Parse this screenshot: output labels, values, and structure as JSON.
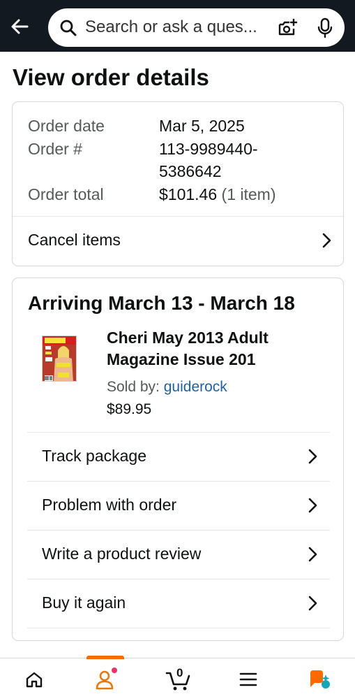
{
  "search": {
    "placeholder": "Search or ask a ques..."
  },
  "page": {
    "title": "View order details"
  },
  "order_summary": {
    "date_label": "Order date",
    "date_value": "Mar 5, 2025",
    "number_label": "Order #",
    "number_line1": "113-9989440-",
    "number_line2": "5386642",
    "total_label": "Order total",
    "total_value": "$101.46",
    "total_items": "(1 item)",
    "cancel_label": "Cancel items"
  },
  "shipment": {
    "arriving": "Arriving March 13 - March 18",
    "product_name": "Cheri May 2013 Adult Magazine Issue 201",
    "sold_by_label": "Sold by:",
    "seller": "guiderock",
    "price": "$89.95",
    "actions": [
      {
        "label": "Track package"
      },
      {
        "label": "Problem with order"
      },
      {
        "label": "Write a product review"
      },
      {
        "label": "Buy it again"
      }
    ]
  },
  "bottom_nav": {
    "cart_count": "0",
    "items": [
      "home-icon",
      "account-icon",
      "cart-icon",
      "menu-icon",
      "assistant-icon"
    ]
  },
  "colors": {
    "topbar": "#131921",
    "accent": "#ff6a00",
    "link": "#2162a1",
    "assistant_blue": "#1aa4b8"
  }
}
